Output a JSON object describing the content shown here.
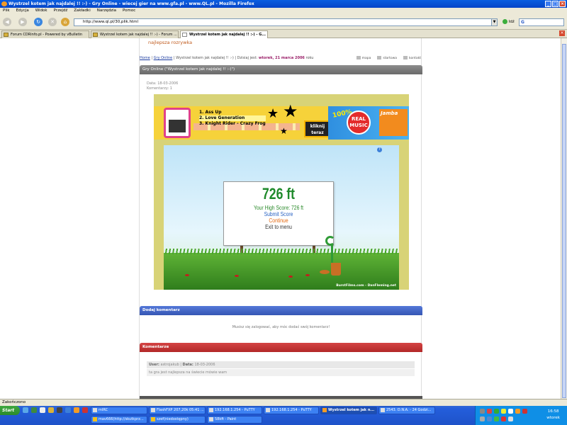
{
  "window": {
    "title": "Wystrzel kotem jak najdalej !! :-) - Gry Online - wiecej gier na www.gfa.pl - www.QL.pl - Mozilla Firefox"
  },
  "menu": [
    "Plik",
    "Edycja",
    "Widok",
    "Przejdź",
    "Zakładki",
    "Narzędzia",
    "Pomoc"
  ],
  "navbar": {
    "url": "http://www.ql.pl/30,plik.html",
    "go_label": "Idź",
    "search_logo": "G"
  },
  "tabs": [
    {
      "label": "Forum CDRinfo.pl - Powered by vBulletin",
      "active": false
    },
    {
      "label": "Wystrzel kotem jak najdalej !! :-) - Forum ...",
      "active": false
    },
    {
      "label": "Wystrzel kotem jak najdalej !! :-) - G...",
      "active": true
    }
  ],
  "page": {
    "slogan": "najlepsza rozrywka",
    "breadcrumb": {
      "home": "Home",
      "games": "Gry Online",
      "current": "Wystrzel kotem jak najdalej !! :-)",
      "today_label": "Dzisiaj jest:",
      "date": "wtorek, 21 marca 2006",
      "year_suffix": "roku"
    },
    "tools": [
      "mapa",
      "startowa",
      "kontakt"
    ],
    "section_title": "Gry Online (\"Wystrzel kotem jak najdalej !! :-)\")",
    "meta": {
      "date": "Data: 18-03-2006",
      "comments": "Komentarzy: 1"
    },
    "banner": {
      "songs": [
        "1. Ass Up",
        "2. Love Generation",
        "3. Knight Rider - Crazy Frog"
      ],
      "click": "kliknij teraz",
      "percent": "100%",
      "music": "REAL MUSIC",
      "brand": "Jamba"
    },
    "game": {
      "distance": "726 ft",
      "high_score": "Your High Score: 726 ft",
      "submit": "Submit Score",
      "continue": "Continue",
      "exit": "Exit to menu",
      "credit": "BurstFilms.com - DanFleming.net"
    },
    "add_comment": {
      "title": "Dodaj komentarz",
      "message": "Musisz się zalogować, aby móc dodać swój komentarz!"
    },
    "comments": {
      "title": "Komentarze",
      "items": [
        {
          "user_label": "User:",
          "user": "astrojakub",
          "date_label": "Data:",
          "date": "18-03-2006",
          "text": "ta gra jest najlepsza na świecie mówie wam"
        }
      ]
    }
  },
  "status": "Zakończono",
  "taskbar": {
    "start": "Start",
    "buttons": [
      {
        "label": "mIRC",
        "active": false
      },
      {
        "label": "FlashFXP 207,20k 05:41 ...",
        "active": false
      },
      {
        "label": "192.168.1.254 - PuTTY",
        "active": false
      },
      {
        "label": "192.168.1.254 - PuTTY",
        "active": false
      },
      {
        "label": "Wystrzel kotem jak n...",
        "active": true
      },
      {
        "label": "2543. D.N.A. - 24 Godzi...",
        "active": false
      },
      {
        "label": "mav666(http://skutkprz...",
        "active": false
      },
      {
        "label": "szef(niedostępny)",
        "active": false
      },
      {
        "label": "58kft - Paint",
        "active": false
      }
    ],
    "clock": "16:58",
    "day": "wtorek"
  }
}
